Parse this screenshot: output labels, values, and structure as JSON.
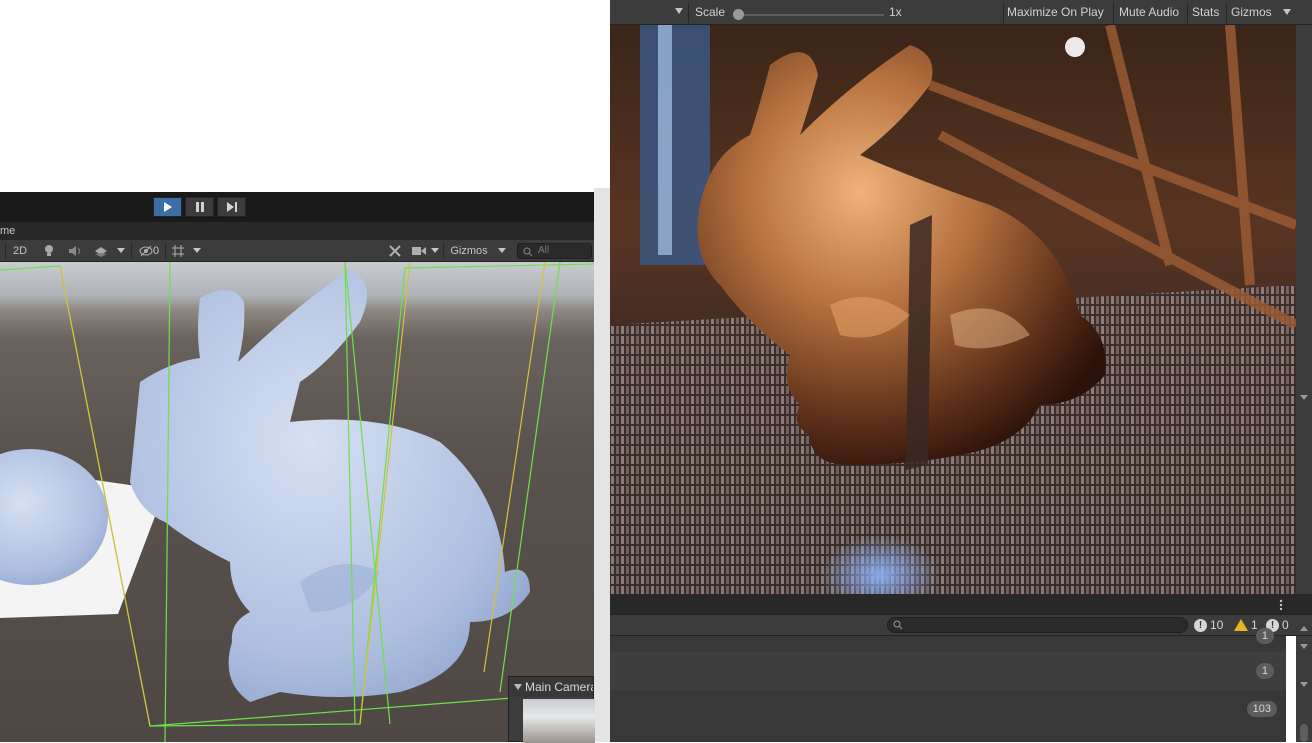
{
  "scene": {
    "tab_label": "me",
    "toolbar": {
      "mode_2d": "2D",
      "hidden_count": "0",
      "gizmos_label": "Gizmos",
      "search_placeholder": "All"
    },
    "camera_preview_title": "Main Camera"
  },
  "game": {
    "scale_label": "Scale",
    "scale_value": "1x",
    "maximize_label": "Maximize On Play",
    "mute_label": "Mute Audio",
    "stats_label": "Stats",
    "gizmos_label": "Gizmos"
  },
  "console": {
    "error_count": "10",
    "warning_count": "1",
    "info_count": "0",
    "rows": [
      {
        "count": "1"
      },
      {
        "count": "1"
      },
      {
        "count": "103"
      }
    ]
  },
  "colors": {
    "editor_dark": "#3c3c3c",
    "play_active": "#3a6ea5",
    "frustum_green": "#6ee04a",
    "frustum_yellow": "#d6c13a",
    "bunny_blue": "#b9c8e6",
    "bunny_copper": "#b5713e"
  }
}
